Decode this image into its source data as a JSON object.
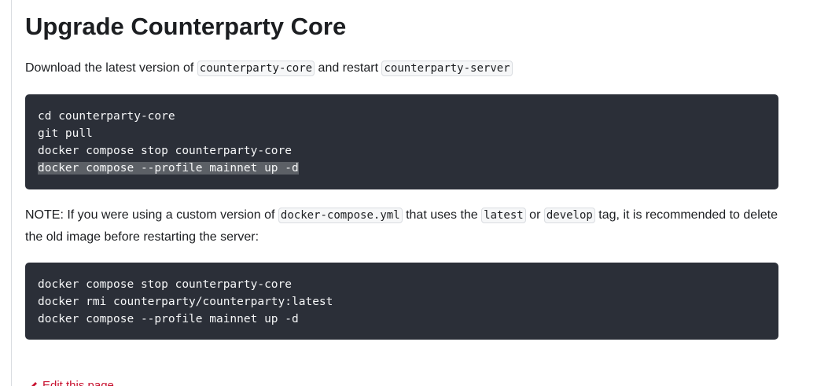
{
  "heading": "Upgrade Counterparty Core",
  "intro": {
    "text_before": "Download the latest version of ",
    "code_core": "counterparty-core",
    "text_mid": " and restart ",
    "code_server": "counterparty-server"
  },
  "code_block_1": {
    "lines": [
      "cd counterparty-core",
      "git pull",
      "docker compose stop counterparty-core",
      "docker compose --profile mainnet up -d"
    ],
    "highlighted_line": "docker compose --profile mainnet up -d"
  },
  "note": {
    "text_1": "NOTE: If you were using a custom version of ",
    "code_file": "docker-compose.yml",
    "text_2": " that uses the ",
    "code_latest": "latest",
    "text_3": " or ",
    "code_develop": "develop",
    "text_4": " tag, it is recommended to delete the old image before restarting the server:"
  },
  "code_block_2": {
    "lines": [
      "docker compose stop counterparty-core",
      "docker rmi counterparty/counterparty:latest",
      "docker compose --profile mainnet up -d"
    ]
  },
  "edit_link": {
    "label": "Edit this page",
    "icon": "pencil-icon"
  },
  "colors": {
    "code_block_bg": "#2b2f38",
    "link": "#c8102e"
  }
}
